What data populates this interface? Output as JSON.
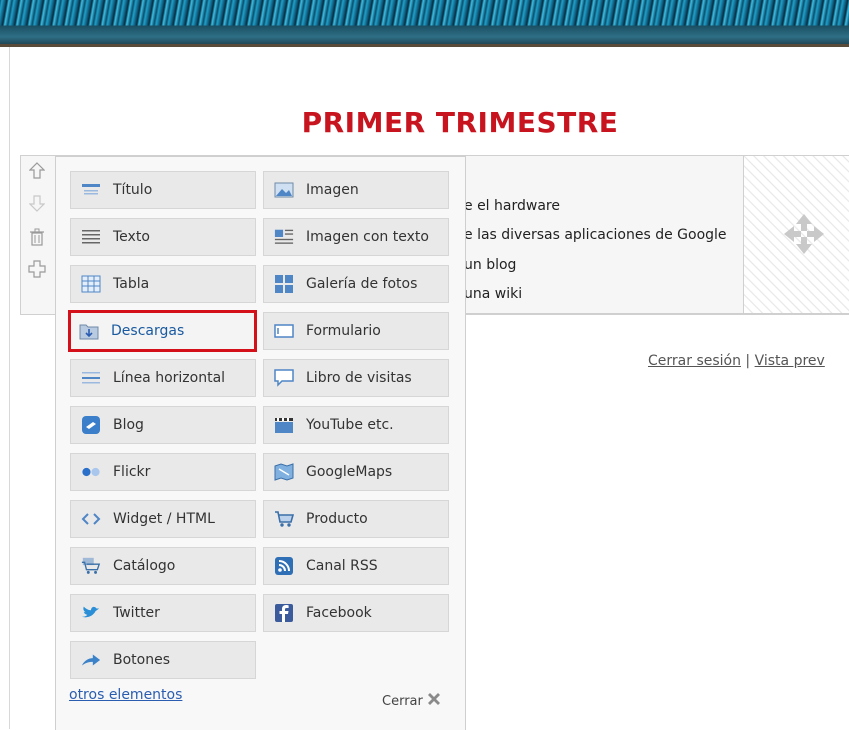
{
  "page": {
    "title": "PRIMER TRIMESTRE"
  },
  "content": {
    "lines": [
      "e el hardware",
      "e las diversas aplicaciones de Google",
      "un blog",
      "una wiki"
    ]
  },
  "session": {
    "logout": "Cerrar sesión",
    "separator": "|",
    "preview": "Vista prev"
  },
  "panel": {
    "items_left": [
      {
        "label": "Título",
        "icon": "title-icon"
      },
      {
        "label": "Texto",
        "icon": "text-icon"
      },
      {
        "label": "Tabla",
        "icon": "table-icon"
      },
      {
        "label": "Descargas",
        "icon": "download-icon",
        "selected": true
      },
      {
        "label": "Línea horizontal",
        "icon": "horizontal-line-icon"
      },
      {
        "label": "Blog",
        "icon": "blog-icon"
      },
      {
        "label": "Flickr",
        "icon": "flickr-icon"
      },
      {
        "label": "Widget / HTML",
        "icon": "widget-icon"
      },
      {
        "label": "Catálogo",
        "icon": "catalog-icon"
      },
      {
        "label": "Twitter",
        "icon": "twitter-icon"
      },
      {
        "label": "Botones",
        "icon": "buttons-icon"
      }
    ],
    "items_right": [
      {
        "label": "Imagen",
        "icon": "image-icon"
      },
      {
        "label": "Imagen con texto",
        "icon": "image-text-icon"
      },
      {
        "label": "Galería de fotos",
        "icon": "gallery-icon"
      },
      {
        "label": "Formulario",
        "icon": "form-icon"
      },
      {
        "label": "Libro de visitas",
        "icon": "guestbook-icon"
      },
      {
        "label": "YouTube etc.",
        "icon": "youtube-icon"
      },
      {
        "label": "GoogleMaps",
        "icon": "googlemaps-icon"
      },
      {
        "label": "Producto",
        "icon": "product-icon"
      },
      {
        "label": "Canal RSS",
        "icon": "rss-icon"
      },
      {
        "label": "Facebook",
        "icon": "facebook-icon"
      }
    ],
    "more_link": "otros elementos",
    "close_label": "Cerrar"
  },
  "colors": {
    "title": "#c8141e",
    "link": "#2a5db0",
    "selected_border": "#d4101a"
  }
}
